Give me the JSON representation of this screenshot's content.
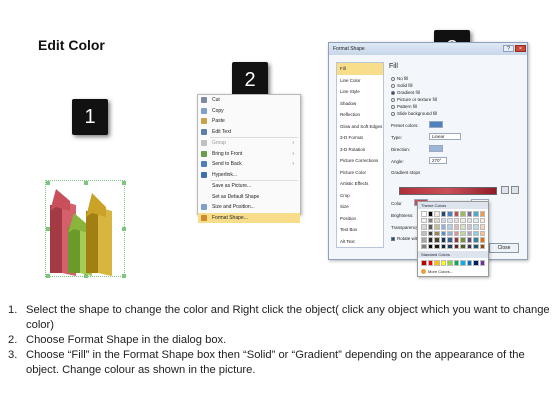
{
  "title": "Edit Color",
  "steps": [
    "1",
    "2",
    "3"
  ],
  "context_menu": {
    "items": [
      {
        "label": "Cut",
        "state": "normal"
      },
      {
        "label": "Copy",
        "state": "normal"
      },
      {
        "label": "Paste",
        "state": "normal"
      },
      {
        "label": "Edit Text",
        "state": "normal"
      },
      {
        "label": "Group",
        "state": "disabled",
        "submenu": true
      },
      {
        "label": "Bring to Front",
        "state": "normal",
        "submenu": true
      },
      {
        "label": "Send to Back",
        "state": "normal",
        "submenu": true
      },
      {
        "label": "Hyperlink...",
        "state": "normal"
      },
      {
        "label": "Save as Picture...",
        "state": "normal"
      },
      {
        "label": "Set as Default Shape",
        "state": "normal"
      },
      {
        "label": "Size and Position...",
        "state": "normal"
      },
      {
        "label": "Format Shape...",
        "state": "highlighted"
      }
    ]
  },
  "dialog": {
    "title": "Format Shape",
    "close_label": "Close",
    "nav": [
      "Fill",
      "Line Color",
      "Line Style",
      "Shadow",
      "Reflection",
      "Glow and Soft Edges",
      "3-D Format",
      "3-D Rotation",
      "Picture Corrections",
      "Picture Color",
      "Artistic Effects",
      "Crop",
      "Size",
      "Position",
      "Text Box",
      "Alt Text"
    ],
    "nav_selected": "Fill",
    "heading": "Fill",
    "options": [
      {
        "label": "No fill",
        "selected": false
      },
      {
        "label": "Solid fill",
        "selected": false
      },
      {
        "label": "Gradient fill",
        "selected": true
      },
      {
        "label": "Picture or texture fill",
        "selected": false
      },
      {
        "label": "Pattern fill",
        "selected": false
      },
      {
        "label": "Slide background fill",
        "selected": false
      }
    ],
    "preset_label": "Preset colors:",
    "type_label": "Type:",
    "type_value": "Linear",
    "direction_label": "Direction:",
    "angle_label": "Angle:",
    "angle_value": "270°",
    "stops_label": "Gradient stops",
    "color_label": "Color",
    "position_label": "Position:",
    "position_value": "0%",
    "brightness_label": "Brightness:",
    "transparency_label": "Transparency:",
    "rotate_label": "Rotate with shape"
  },
  "palette": {
    "theme_label": "Theme Colors",
    "standard_label": "Standard Colors",
    "more_label": "More Colors...",
    "theme_rows": [
      [
        "#ffffff",
        "#000000",
        "#eeece1",
        "#1f497d",
        "#4f81bd",
        "#c0504d",
        "#9bbb59",
        "#8064a2",
        "#4bacc6",
        "#f79646"
      ],
      [
        "#f2f2f2",
        "#7f7f7f",
        "#ddd9c3",
        "#c6d9f0",
        "#dbe5f1",
        "#f2dcdb",
        "#ebf1dd",
        "#e5e0ec",
        "#dbeef3",
        "#fdeada"
      ],
      [
        "#d8d8d8",
        "#595959",
        "#c4bd97",
        "#8db3e2",
        "#b8cce4",
        "#e5b9b7",
        "#d7e3bc",
        "#ccc1d9",
        "#b7dde8",
        "#fbd5b5"
      ],
      [
        "#bfbfbf",
        "#3f3f3f",
        "#938953",
        "#548dd4",
        "#95b3d7",
        "#d99694",
        "#c3d69b",
        "#b2a2c7",
        "#92cddc",
        "#fac08f"
      ],
      [
        "#a5a5a5",
        "#262626",
        "#494429",
        "#17365d",
        "#366092",
        "#953734",
        "#76923c",
        "#5f497a",
        "#31859b",
        "#e36c09"
      ],
      [
        "#7f7f7f",
        "#0c0c0c",
        "#1d1b10",
        "#0f243e",
        "#244061",
        "#632423",
        "#4f6128",
        "#3f3151",
        "#205867",
        "#974806"
      ]
    ],
    "standard_colors": [
      "#c00000",
      "#ff0000",
      "#ffc000",
      "#ffff00",
      "#92d050",
      "#00b050",
      "#00b0f0",
      "#0070c0",
      "#002060",
      "#7030a0"
    ]
  },
  "instructions": [
    {
      "num": "1.",
      "text": "Select the shape to change the color and Right click the object( click any object which you want to change color)"
    },
    {
      "num": "2.",
      "text": "Choose Format Shape in the dialog box."
    },
    {
      "num": "3.",
      "text": "Choose “Fill” in the Format Shape box then “Solid” or “Gradient” depending on the appearance of the object. Change colour as shown in the picture."
    }
  ],
  "colors": {
    "accent_red": "#c9505a",
    "accent_green": "#8ab43a",
    "accent_yellow": "#c9a227",
    "highlight": "#f8de8a"
  }
}
